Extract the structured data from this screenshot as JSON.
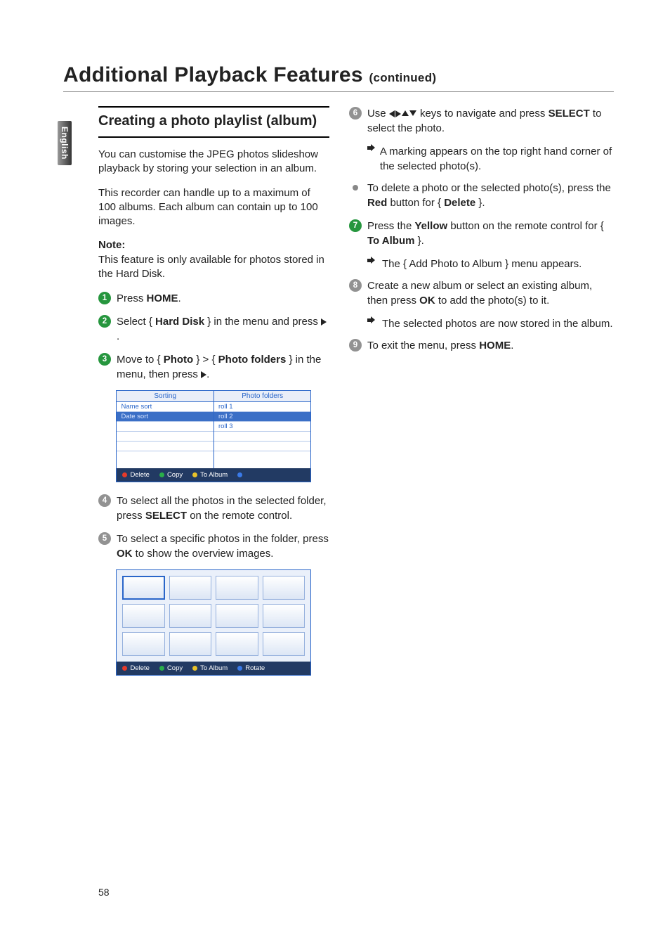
{
  "side_tab": "English",
  "title_main": "Additional Playback Features ",
  "title_cont": "(continued)",
  "h2": "Creating a photo playlist (album)",
  "left": {
    "p1": "You can customise the JPEG photos slideshow playback by storing your selection in an album.",
    "p2": "This recorder can handle up to a maximum of 100 albums.  Each album can contain up to 100 images.",
    "note_label": "Note:",
    "note_body": "This feature is only available for photos stored in the Hard Disk.",
    "s1_a": "Press ",
    "s1_b": "HOME",
    "s1_c": ".",
    "s2_a": "Select { ",
    "s2_b": "Hard Disk",
    "s2_c": " } in the menu and press ",
    "s3_a": "Move to { ",
    "s3_b": "Photo",
    "s3_c": " } > { ",
    "s3_d": "Photo folders",
    "s3_e": " } in the menu, then press ",
    "s4": "To select all the photos in the selected folder, press ",
    "s4_b": "SELECT",
    "s4_c": " on the remote control.",
    "s5": "To select a specific photos in the folder, press ",
    "s5_b": "OK",
    "s5_c": " to show the overview images."
  },
  "shot1": {
    "col1_hdr": "Sorting",
    "col1_r1": "Name sort",
    "col1_r2": "Date sort",
    "col2_hdr": "Photo folders",
    "col2_r1": "roll 1",
    "col2_r2": "roll 2",
    "col2_r3": "roll 3",
    "f1": "Delete",
    "f2": "Copy",
    "f3": "To Album"
  },
  "shot2": {
    "f1": "Delete",
    "f2": "Copy",
    "f3": "To Album",
    "f4": "Rotate"
  },
  "right": {
    "s6_a": "Use ",
    "s6_b": " keys to navigate and press ",
    "s6_c": "SELECT",
    "s6_d": " to select the photo.",
    "s6_sub": " A marking appears on the top right hand corner of the selected photo(s).",
    "bullet_a": "To delete a photo or the selected photo(s), press the ",
    "bullet_b": "Red",
    "bullet_c": " button for { ",
    "bullet_d": "Delete",
    "bullet_e": " }.",
    "s7_a": "Press the ",
    "s7_b": "Yellow",
    "s7_c": " button on the remote control for { ",
    "s7_d": "To Album",
    "s7_e": " }.",
    "s7_sub": " The { Add Photo to Album } menu appears.",
    "s8_a": "Create a new album or select an existing album, then press ",
    "s8_b": "OK",
    "s8_c": " to add the photo(s) to it.",
    "s8_sub": " The selected photos are now stored in the album.",
    "s9_a": "To exit the menu, press ",
    "s9_b": "HOME",
    "s9_c": "."
  },
  "pagenum": "58"
}
